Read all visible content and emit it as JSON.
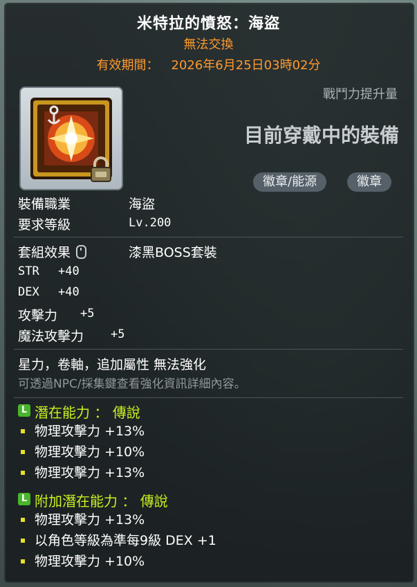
{
  "item": {
    "name": "米特拉的憤怒：海盜",
    "trade_status": "無法交換",
    "expiry_label": "有效期間：",
    "expiry_value": "2026年6月25日03時02分"
  },
  "icon": {
    "name": "pirate-emblem-icon",
    "lock": "lock-icon"
  },
  "comparison": {
    "power_label": "戰鬥力提升量",
    "equipped_text": "目前穿戴中的裝備"
  },
  "badges": [
    "徽章/能源",
    "徽章"
  ],
  "requirements": {
    "job_label": "裝備職業",
    "job_value": "海盜",
    "level_label": "要求等級",
    "level_value": "Lv.200"
  },
  "set": {
    "label": "套組效果",
    "value": "漆黑BOSS套裝"
  },
  "stats": [
    {
      "name": "STR",
      "value": "+40"
    },
    {
      "name": "DEX",
      "value": "+40"
    },
    {
      "name": "攻擊力",
      "value": "+5"
    },
    {
      "name": "魔法攻擊力",
      "value": "+5"
    }
  ],
  "notes": {
    "restrictions": "星力，卷軸，追加屬性 無法強化",
    "hint": "可透過NPC/採集鍵查看強化資訊詳細內容。"
  },
  "potential": {
    "grade_letter": "L",
    "title": "潛在能力 ： 傳說",
    "lines": [
      "物理攻擊力 +13%",
      "物理攻擊力 +10%",
      "物理攻擊力 +13%"
    ]
  },
  "additional_potential": {
    "grade_letter": "L",
    "title": "附加潛在能力 ： 傳說",
    "lines": [
      "物理攻擊力 +13%",
      "以角色等級為準每9級 DEX +1",
      "物理攻擊力 +10%"
    ]
  },
  "colors": {
    "title": "#ffffff",
    "trade": "#ff9a2e",
    "legendary_green": "#49b52a",
    "section_title": "#c9f020",
    "bullet": "#e6e02b"
  }
}
